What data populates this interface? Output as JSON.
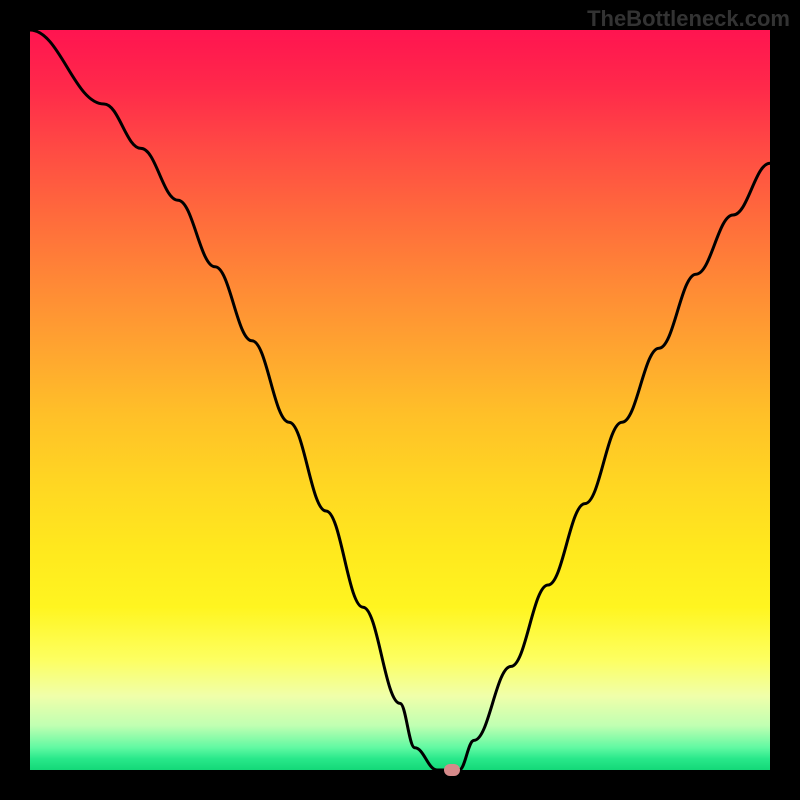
{
  "watermark": "TheBottleneck.com",
  "chart_data": {
    "type": "line",
    "title": "",
    "xlabel": "",
    "ylabel": "",
    "xlim": [
      0,
      100
    ],
    "ylim": [
      0,
      100
    ],
    "series": [
      {
        "name": "bottleneck-curve",
        "x": [
          0,
          10,
          15,
          20,
          25,
          30,
          35,
          40,
          45,
          50,
          52,
          55,
          58,
          60,
          65,
          70,
          75,
          80,
          85,
          90,
          95,
          100
        ],
        "values": [
          100,
          90,
          84,
          77,
          68,
          58,
          47,
          35,
          22,
          9,
          3,
          0,
          0,
          4,
          14,
          25,
          36,
          47,
          57,
          67,
          75,
          82
        ]
      }
    ],
    "minimum_point": {
      "x": 57,
      "y": 0
    }
  },
  "colors": {
    "curve": "#000000",
    "marker": "#d68a8a",
    "background_frame": "#000000"
  }
}
